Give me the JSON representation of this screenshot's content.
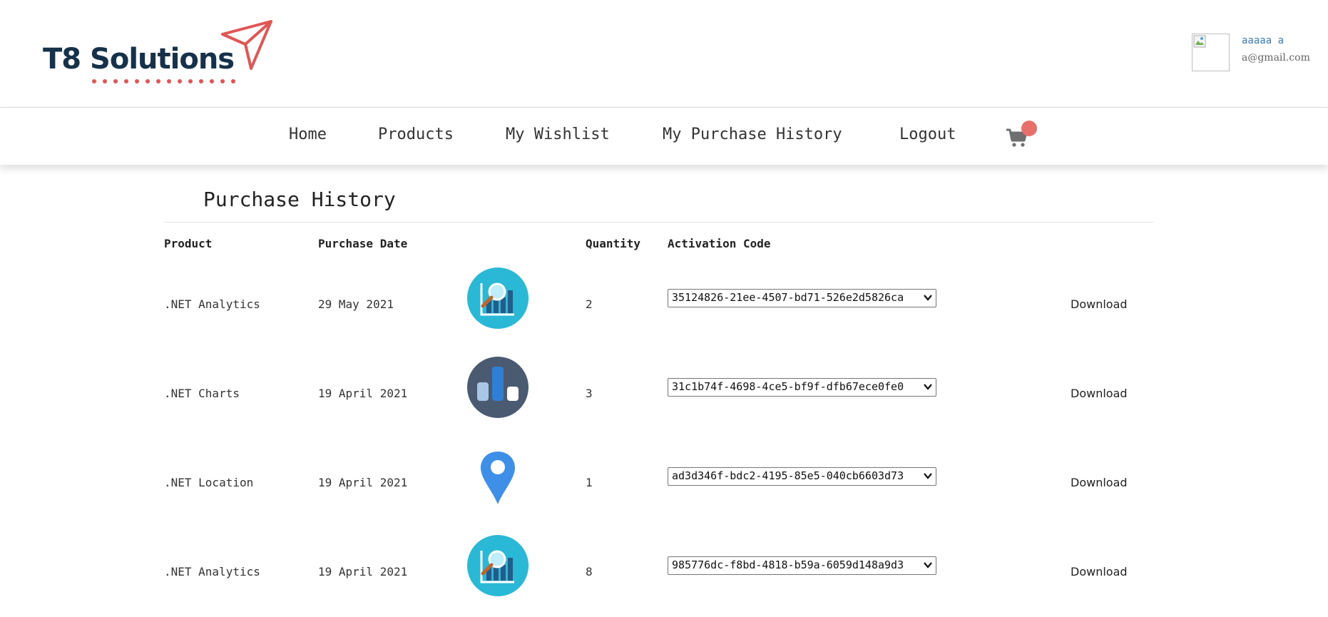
{
  "brand": {
    "name": "T8 Solutions",
    "accent": "#e25555",
    "primary": "#16324a"
  },
  "user": {
    "name": "aaaaa a",
    "email": "a@gmail.com",
    "avatar_icon": "broken-image-icon"
  },
  "nav": {
    "items": [
      "Home",
      "Products",
      "My Wishlist",
      "My Purchase History",
      "Logout"
    ],
    "cart_icon": "cart-icon",
    "badge_color": "#e8706a"
  },
  "page": {
    "title": "Purchase History"
  },
  "table": {
    "columns": [
      "Product",
      "Purchase Date",
      "Quantity",
      "Activation Code"
    ],
    "rows": [
      {
        "product": ".NET Analytics",
        "date": "29 May 2021",
        "icon": "analytics-icon",
        "quantity": "2",
        "code": "35124826-21ee-4507-bd71-526e2d5826ca",
        "action": "Download"
      },
      {
        "product": ".NET Charts",
        "date": "19 April 2021",
        "icon": "bar-chart-icon",
        "quantity": "3",
        "code": "31c1b74f-4698-4ce5-bf9f-dfb67ece0fe0",
        "action": "Download"
      },
      {
        "product": ".NET Location",
        "date": "19 April 2021",
        "icon": "location-pin-icon",
        "quantity": "1",
        "code": "ad3d346f-bdc2-4195-85e5-040cb6603d73",
        "action": "Download"
      },
      {
        "product": ".NET Analytics",
        "date": "19 April 2021",
        "icon": "analytics-icon",
        "quantity": "8",
        "code": "985776dc-f8bd-4818-b59a-6059d148a9d3",
        "action": "Download"
      }
    ]
  }
}
